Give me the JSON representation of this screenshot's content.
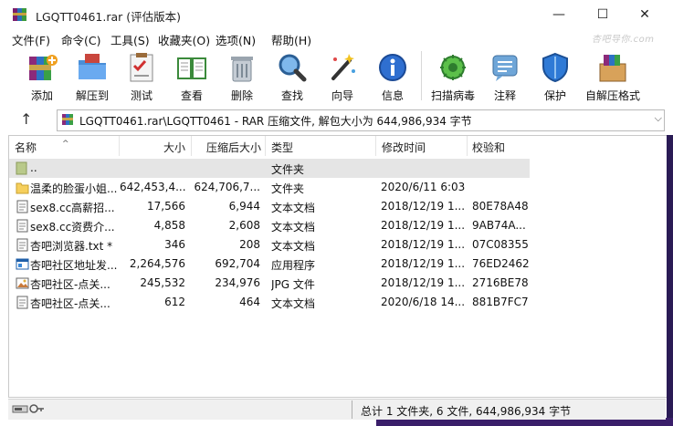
{
  "window": {
    "title": "LGQTT0461.rar (评估版本)",
    "minimize": "—",
    "maximize": "☐",
    "close": "✕"
  },
  "menu": [
    {
      "label": "文件(F)"
    },
    {
      "label": "命令(C)"
    },
    {
      "label": "工具(S)"
    },
    {
      "label": "收藏夹(O)"
    },
    {
      "label": "选项(N)"
    },
    {
      "label": "帮助(H)"
    }
  ],
  "watermark": "杏吧导你.com",
  "toolbar": [
    {
      "label": "添加",
      "icon": "add-books-icon"
    },
    {
      "label": "解压到",
      "icon": "extract-folder-icon"
    },
    {
      "label": "测试",
      "icon": "test-clipboard-icon"
    },
    {
      "label": "查看",
      "icon": "view-book-icon"
    },
    {
      "label": "删除",
      "icon": "delete-trash-icon"
    },
    {
      "label": "查找",
      "icon": "find-magnifier-icon"
    },
    {
      "label": "向导",
      "icon": "wizard-wand-icon"
    },
    {
      "label": "信息",
      "icon": "info-icon"
    },
    {
      "label": "扫描病毒",
      "icon": "virus-scan-icon"
    },
    {
      "label": "注释",
      "icon": "comment-icon"
    },
    {
      "label": "保护",
      "icon": "protect-shield-icon"
    },
    {
      "label": "自解压格式",
      "icon": "sfx-box-icon"
    }
  ],
  "address": {
    "up": "↑",
    "path": "LGQTT0461.rar\\LGQTT0461 - RAR 压缩文件, 解包大小为 644,986,934 字节",
    "chevron": "⌵"
  },
  "columns": {
    "name": "名称",
    "size": "大小",
    "packed": "压缩后大小",
    "type": "类型",
    "modified": "修改时间",
    "crc": "校验和",
    "sort_caret": "^"
  },
  "files": [
    {
      "name": "..",
      "size": "",
      "packed": "",
      "type": "文件夹",
      "modified": "",
      "crc": "",
      "icon": "parent-folder-icon"
    },
    {
      "name": "温柔的脸蛋小姐...",
      "size": "642,453,4...",
      "packed": "624,706,7...",
      "type": "文件夹",
      "modified": "2020/6/11 6:03",
      "crc": "",
      "icon": "folder-icon"
    },
    {
      "name": "sex8.cc高薪招...",
      "size": "17,566",
      "packed": "6,944",
      "type": "文本文档",
      "modified": "2018/12/19 1...",
      "crc": "80E78A48",
      "icon": "text-file-icon"
    },
    {
      "name": "sex8.cc资费介...",
      "size": "4,858",
      "packed": "2,608",
      "type": "文本文档",
      "modified": "2018/12/19 1...",
      "crc": "9AB74A...",
      "icon": "text-file-icon"
    },
    {
      "name": "杏吧浏览器.txt *",
      "size": "346",
      "packed": "208",
      "type": "文本文档",
      "modified": "2018/12/19 1...",
      "crc": "07C08355",
      "icon": "text-file-icon"
    },
    {
      "name": "杏吧社区地址发...",
      "size": "2,264,576",
      "packed": "692,704",
      "type": "应用程序",
      "modified": "2018/12/19 1...",
      "crc": "76ED2462",
      "icon": "application-icon"
    },
    {
      "name": "杏吧社区-点关...",
      "size": "245,532",
      "packed": "234,976",
      "type": "JPG 文件",
      "modified": "2018/12/19 1...",
      "crc": "2716BE78",
      "icon": "image-file-icon"
    },
    {
      "name": "杏吧社区-点关...",
      "size": "612",
      "packed": "464",
      "type": "文本文档",
      "modified": "2020/6/18 14...",
      "crc": "881B7FC7",
      "icon": "text-file-icon"
    }
  ],
  "status": {
    "text": "总计 1 文件夹, 6 文件, 644,986,934 字节"
  }
}
